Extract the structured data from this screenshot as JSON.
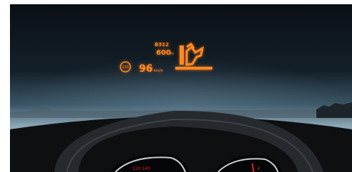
{
  "hud": {
    "road_id": "B312",
    "distance": "600",
    "distance_unit": "m",
    "speed_limit": "100",
    "speed": "96",
    "speed_unit": "km/h",
    "maneuver_icon": "junction-turn-right-icon"
  },
  "colors": {
    "hud_orange": "#ff8a24",
    "needle_red": "#e02020"
  },
  "cluster": {
    "left_gauge_text": "120 140",
    "right_gauge_text": "4"
  }
}
